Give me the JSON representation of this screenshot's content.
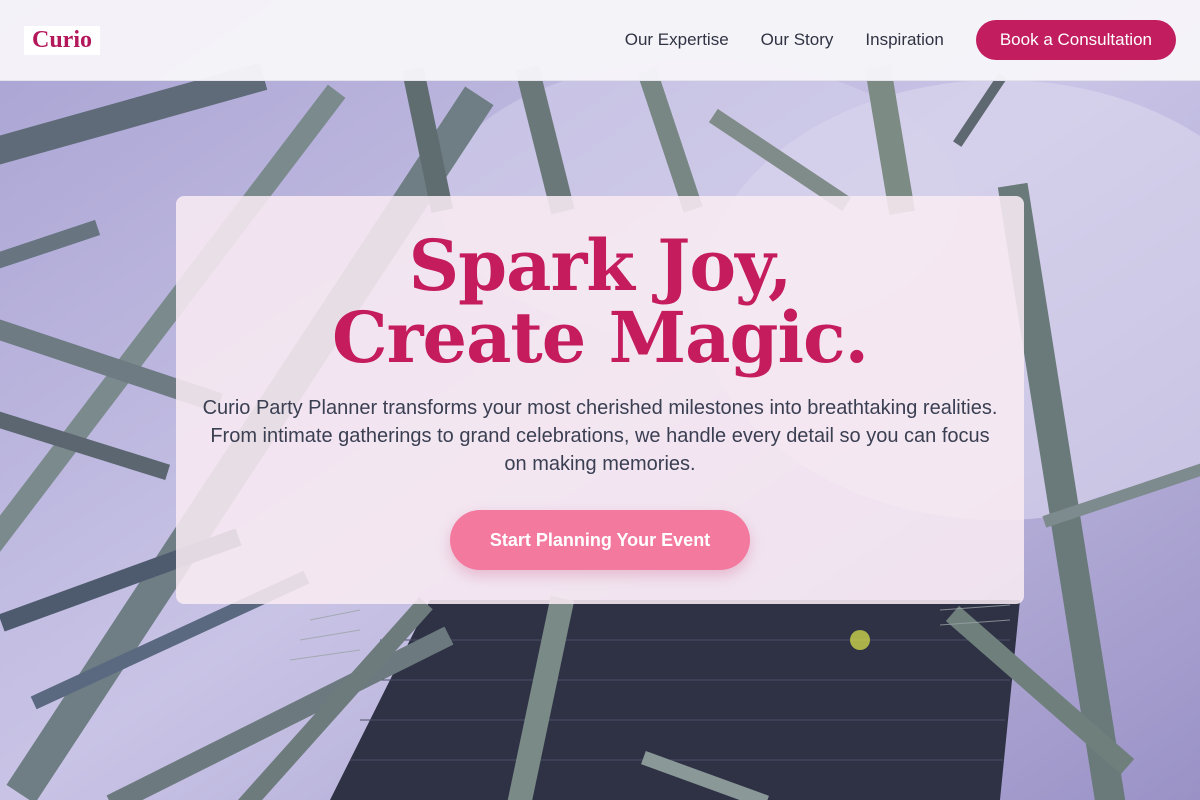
{
  "brand": {
    "logo_text": "Curio",
    "accent_color": "#c11d5f"
  },
  "nav": {
    "links": [
      "Our Expertise",
      "Our Story",
      "Inspiration"
    ],
    "cta_label": "Book a Consultation"
  },
  "hero": {
    "title": "Spark Joy, Create Magic.",
    "description": "Curio Party Planner transforms your most cherished milestones into breathtaking realities. From intimate gatherings to grand celebrations, we handle every detail so you can focus on making memories.",
    "button_label": "Start Planning Your Event",
    "button_color": "#f3799f",
    "background_image": "steel-truss-rigging-photo"
  }
}
